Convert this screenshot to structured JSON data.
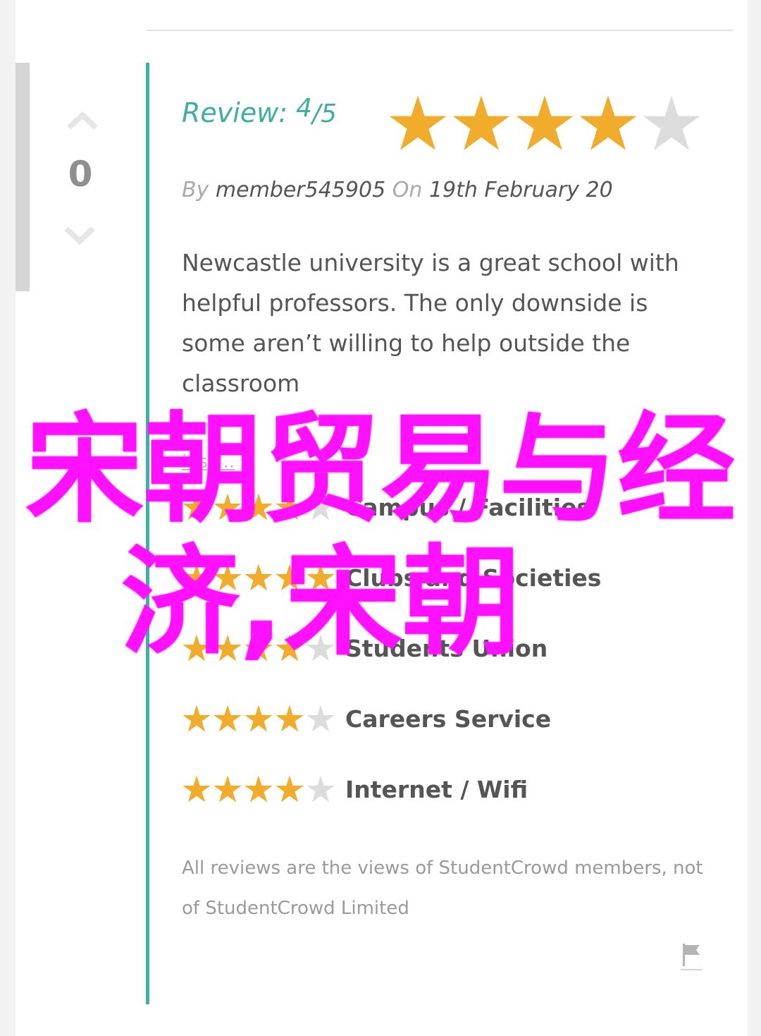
{
  "colors": {
    "accent": "#3fb0a4",
    "star_filled": "#f0ac2a",
    "star_empty": "#dcdcdc",
    "overlay_text": "#ff10ff"
  },
  "vote": {
    "count": "0",
    "up_icon": "chevron-up-icon",
    "down_icon": "chevron-down-icon"
  },
  "review": {
    "label": "Review:",
    "score": "4",
    "out_of": "/5",
    "rating": 4,
    "max_rating": 5,
    "by_label": "By",
    "author": "member545905",
    "on_label": "On",
    "date": "19th February 20",
    "body": "Newcastle university is a great school with helpful professors. The only downside is some aren’t willing to help outside the classroom",
    "less_link": "less..."
  },
  "categories": [
    {
      "label": "Campus / Facilities",
      "rating": 4
    },
    {
      "label": "Clubs and Societies",
      "rating": 5
    },
    {
      "label": "Students Union",
      "rating": 4
    },
    {
      "label": "Careers Service",
      "rating": 4
    },
    {
      "label": "Internet / Wifi",
      "rating": 4
    }
  ],
  "disclaimer": "All reviews are the views of StudentCrowd members, not of StudentCrowd Limited",
  "flag_icon": "flag-icon",
  "overlay": {
    "line1": "宋朝贸易与经",
    "line2": "济,宋朝"
  }
}
